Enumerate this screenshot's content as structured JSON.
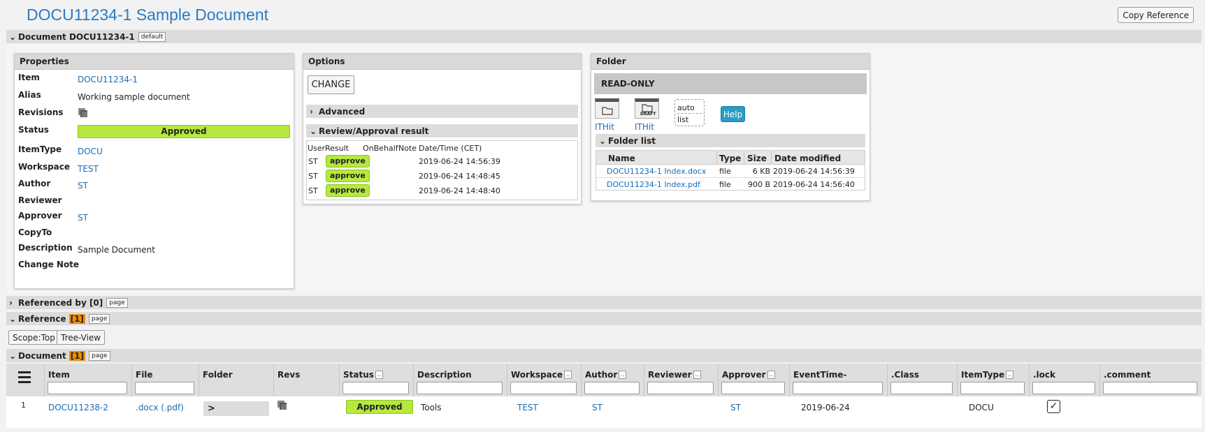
{
  "page": {
    "title": "DOCU11234-1 Sample Document",
    "copy_reference_label": "Copy Reference"
  },
  "document_section": {
    "label": "Document DOCU11234-1",
    "tag": "default"
  },
  "properties": {
    "header": "Properties",
    "rows": [
      {
        "label": "Item",
        "value": "DOCU11234-1"
      },
      {
        "label": "Alias",
        "value": "Working sample document"
      },
      {
        "label": "Revisions",
        "value": ""
      },
      {
        "label": "Status",
        "value": "Approved"
      },
      {
        "label": "ItemType",
        "value": "DOCU"
      },
      {
        "label": "Workspace",
        "value": "TEST"
      },
      {
        "label": "Author",
        "value": "ST"
      },
      {
        "label": "Reviewer",
        "value": ""
      },
      {
        "label": "Approver",
        "value": "ST"
      },
      {
        "label": "CopyTo",
        "value": ""
      },
      {
        "label": "Description",
        "value": "Sample Document"
      },
      {
        "label": "Change Note",
        "value": ""
      }
    ],
    "status_color": "#b7e83e"
  },
  "options": {
    "header": "Options",
    "change_label": "CHANGE",
    "advanced_label": "Advanced",
    "review_label": "Review/Approval result",
    "review_columns": [
      "User",
      "Result",
      "OnBehalf",
      "Note",
      "Date/Time (CET)"
    ],
    "review_rows": [
      {
        "user": "ST",
        "result": "approve",
        "datetime": "2019-06-24 14:56:39"
      },
      {
        "user": "ST",
        "result": "approve",
        "datetime": "2019-06-24 14:48:45"
      },
      {
        "user": "ST",
        "result": "approve",
        "datetime": "2019-06-24 14:48:40"
      }
    ]
  },
  "folder": {
    "header": "Folder",
    "readonly_label": "READ-ONLY",
    "icons": [
      {
        "name": "folder-icon",
        "label": "ITHit"
      },
      {
        "name": "draft-folder-icon",
        "label": "ITHit",
        "badge": "DRAFT"
      }
    ],
    "modes": [
      "auto",
      "list"
    ],
    "help_label": "Help",
    "folder_list_label": "Folder list",
    "columns": [
      "Name",
      "Type",
      "Size",
      "Date modified"
    ],
    "files": [
      {
        "name": "DOCU11234-1 Index.docx",
        "type": "file",
        "size": "6 KB",
        "modified": "2019-06-24 14:56:39"
      },
      {
        "name": "DOCU11234-1 Index.pdf",
        "type": "file",
        "size": "900 B",
        "modified": "2019-06-24 14:56:40"
      }
    ]
  },
  "referenced_by": {
    "label": "Referenced by [0]",
    "tag": "page"
  },
  "reference": {
    "label": "Reference",
    "count": "[1]",
    "tag": "page",
    "scope_label": "Scope:Top",
    "tree_view_label": "Tree-View"
  },
  "document_list": {
    "label": "Document",
    "count": "[1]",
    "tag": "page",
    "columns": [
      {
        "label": "Item",
        "filter": false
      },
      {
        "label": "File",
        "filter": false
      },
      {
        "label": "Folder",
        "filter": false
      },
      {
        "label": "Revs",
        "filter": false
      },
      {
        "label": "Status",
        "filter": true
      },
      {
        "label": "Description",
        "filter": false
      },
      {
        "label": "Workspace",
        "filter": true
      },
      {
        "label": "Author",
        "filter": true
      },
      {
        "label": "Reviewer",
        "filter": true
      },
      {
        "label": "Approver",
        "filter": true
      },
      {
        "label": "EventTime-",
        "filter": false
      },
      {
        "label": ".Class",
        "filter": false
      },
      {
        "label": "ItemType",
        "filter": true
      },
      {
        "label": ".lock",
        "filter": false
      },
      {
        "label": ".comment",
        "filter": false
      }
    ],
    "filter_x": "..",
    "row": {
      "index": "1",
      "item": "DOCU11238-2",
      "file": ".docx (.pdf)",
      "folder": ">",
      "status": "Approved",
      "description": "Tools",
      "workspace": "TEST",
      "author": "ST",
      "approver": "ST",
      "eventtime": "2019-06-24",
      "itemtype": "DOCU",
      "lock": "✓"
    }
  }
}
